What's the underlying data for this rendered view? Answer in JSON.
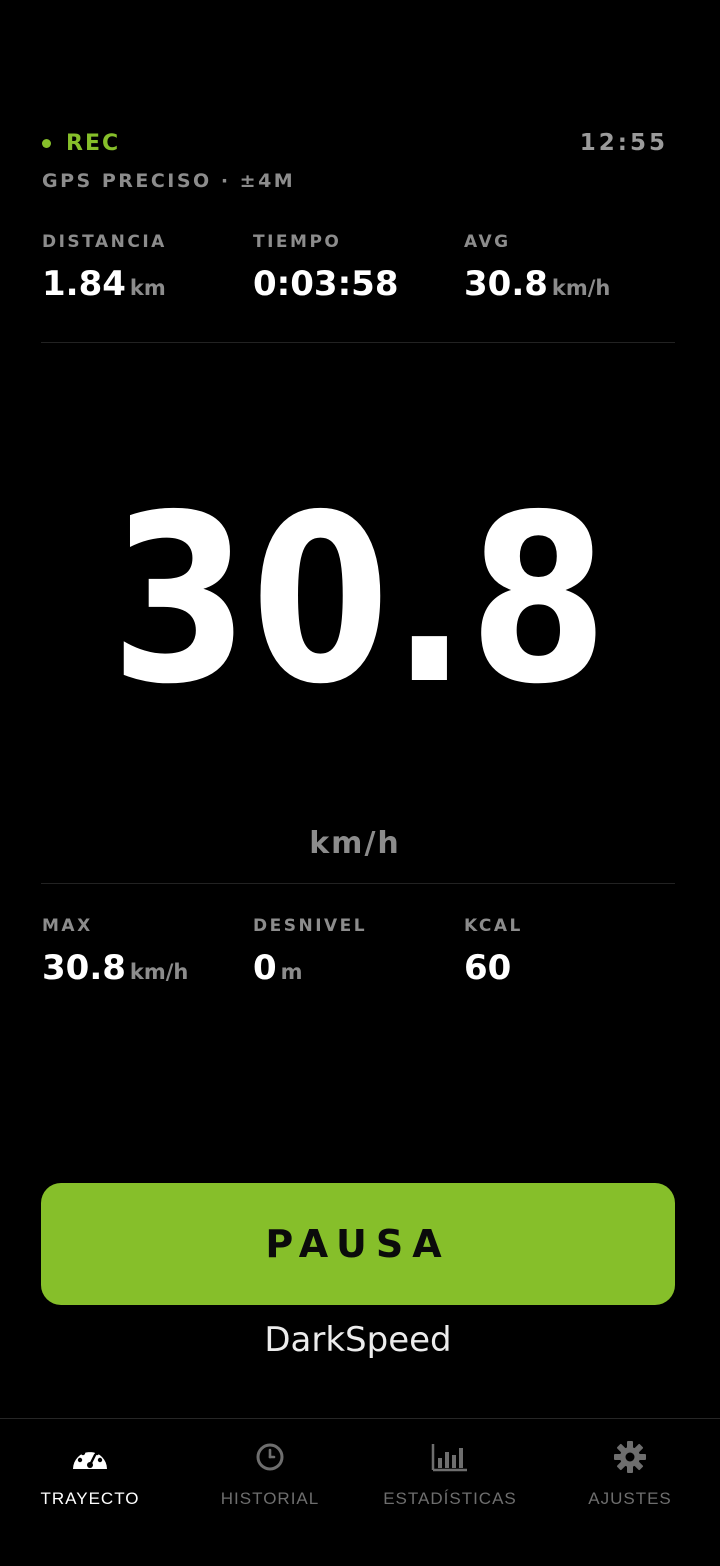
{
  "status": {
    "rec_label": "REC",
    "clock": "12:55",
    "gps": "GPS PRECISO · ±4M"
  },
  "top_stats": [
    {
      "label": "DISTANCIA",
      "value": "1.84",
      "unit": "km"
    },
    {
      "label": "TIEMPO",
      "value": "0:03:58",
      "unit": ""
    },
    {
      "label": "AVG",
      "value": "30.8",
      "unit": "km/h"
    }
  ],
  "speed": {
    "value": "30.8",
    "unit": "km/h"
  },
  "bottom_stats": [
    {
      "label": "MAX",
      "value": "30.8",
      "unit": "km/h"
    },
    {
      "label": "DESNIVEL",
      "value": "0",
      "unit": "m"
    },
    {
      "label": "KCAL",
      "value": "60",
      "unit": ""
    }
  ],
  "pause_button": {
    "label": "PAUSA"
  },
  "brand": "DarkSpeed",
  "nav": [
    {
      "label": "TRAYECTO",
      "icon": "speedometer-icon",
      "active": true
    },
    {
      "label": "HISTORIAL",
      "icon": "clock-icon",
      "active": false
    },
    {
      "label": "ESTADÍSTICAS",
      "icon": "bar-chart-icon",
      "active": false
    },
    {
      "label": "AJUSTES",
      "icon": "gear-icon",
      "active": false
    }
  ],
  "colors": {
    "accent": "#86bf2a",
    "background": "#000000",
    "muted": "#8c8c8c"
  }
}
